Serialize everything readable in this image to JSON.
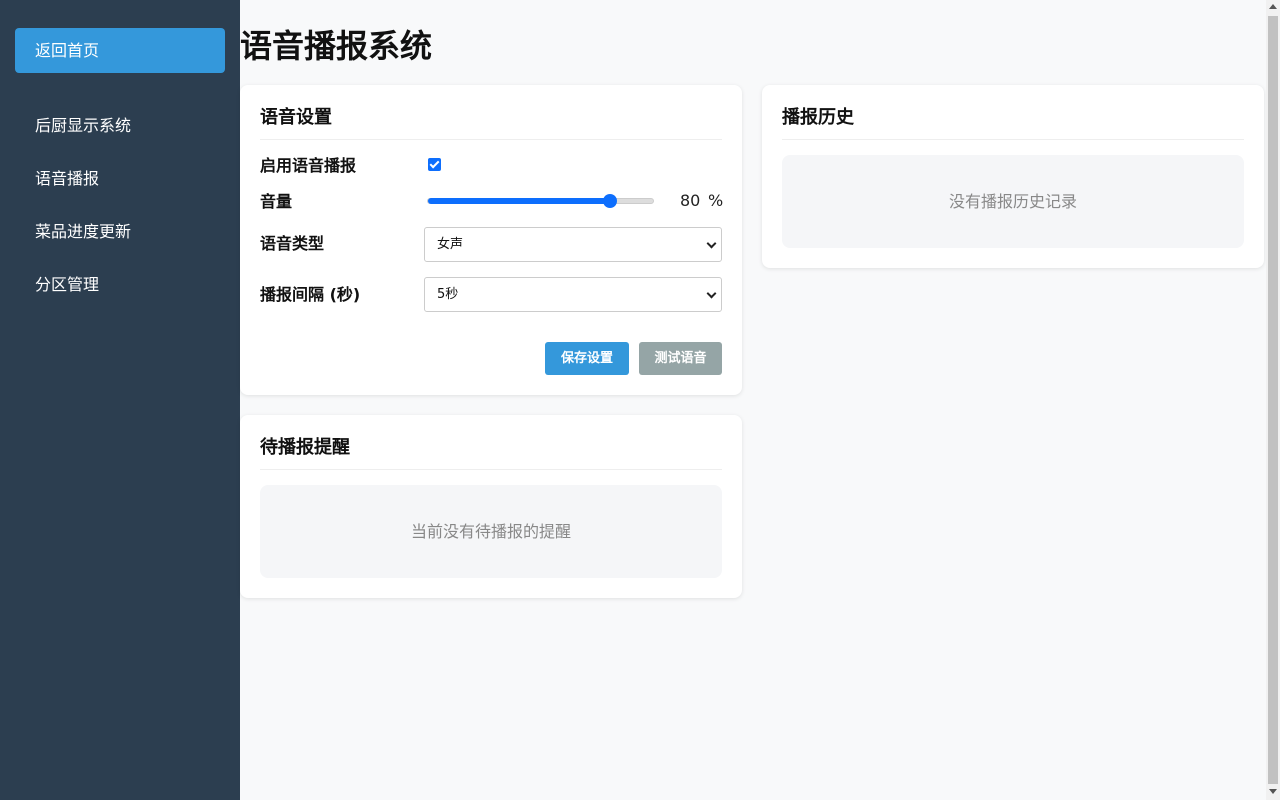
{
  "sidebar": {
    "back_label": "返回首页",
    "items": [
      {
        "label": "后厨显示系统"
      },
      {
        "label": "语音播报"
      },
      {
        "label": "菜品进度更新"
      },
      {
        "label": "分区管理"
      }
    ]
  },
  "page": {
    "title": "语音播报系统"
  },
  "settings": {
    "title": "语音设置",
    "enable_label": "启用语音播报",
    "enabled": true,
    "volume_label": "音量",
    "volume_value": "80",
    "volume_unit": "%",
    "volume_fraction": 0.8,
    "voice_type_label": "语音类型",
    "voice_type_value": "女声",
    "interval_label": "播报间隔 (秒)",
    "interval_value": "5秒",
    "save_label": "保存设置",
    "test_label": "测试语音"
  },
  "pending": {
    "title": "待播报提醒",
    "empty_text": "当前没有待播报的提醒"
  },
  "history": {
    "title": "播报历史",
    "empty_text": "没有播报历史记录"
  },
  "colors": {
    "sidebar_bg": "#2c3e50",
    "accent": "#3498db",
    "secondary_button": "#95a5a6",
    "control_blue": "#0d6efd"
  }
}
